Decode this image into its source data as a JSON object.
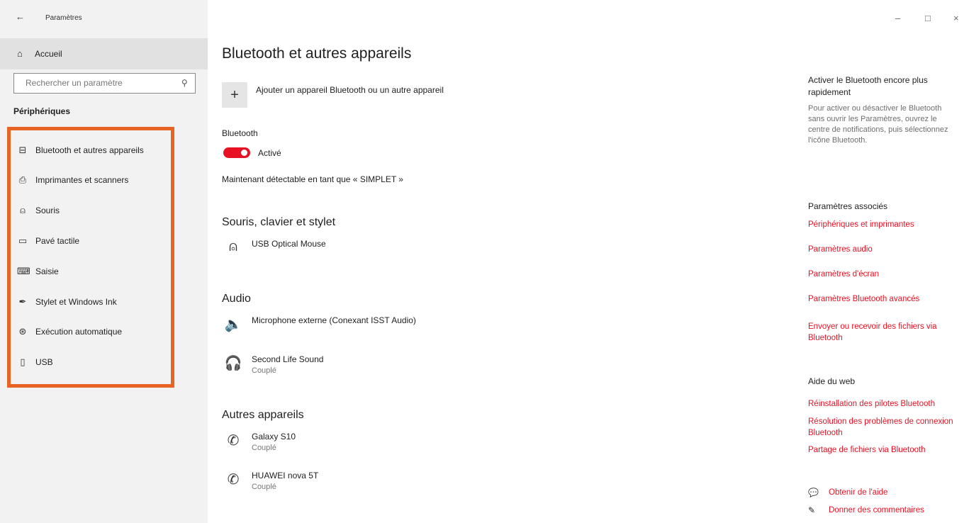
{
  "window": {
    "back_icon": "arrow-left-icon",
    "back_glyph": "←",
    "title": "Paramètres",
    "minimize": "–",
    "maximize": "□",
    "close": "×"
  },
  "sidebar": {
    "home": {
      "icon": "home-icon",
      "glyph": "⌂",
      "label": "Accueil"
    },
    "search": {
      "placeholder": "Rechercher un paramètre",
      "icon": "search-icon",
      "glyph": "⚲"
    },
    "section": "Périphériques",
    "items": [
      {
        "icon": "bluetooth-devices-icon",
        "glyph": "⊟",
        "label": "Bluetooth et autres appareils"
      },
      {
        "icon": "printer-icon",
        "glyph": "⎙",
        "label": "Imprimantes et scanners"
      },
      {
        "icon": "mouse-icon",
        "glyph": "⍝",
        "label": "Souris"
      },
      {
        "icon": "touchpad-icon",
        "glyph": "▭",
        "label": "Pavé tactile"
      },
      {
        "icon": "keyboard-icon",
        "glyph": "⌨",
        "label": "Saisie"
      },
      {
        "icon": "pen-icon",
        "glyph": "✒",
        "label": "Stylet et Windows Ink"
      },
      {
        "icon": "autoplay-icon",
        "glyph": "⊛",
        "label": "Exécution automatique"
      },
      {
        "icon": "usb-icon",
        "glyph": "▯",
        "label": "USB"
      }
    ],
    "highlight_color": "#e86424"
  },
  "main": {
    "title": "Bluetooth et autres appareils",
    "add_icon": "plus-icon",
    "add_glyph": "+",
    "add_label": "Ajouter un appareil Bluetooth ou un autre appareil",
    "bluetooth_label": "Bluetooth",
    "toggle_state": "Activé",
    "toggle_on": true,
    "toggle_color": "#e81123",
    "discoverable": "Maintenant détectable en tant que « SIMPLET »",
    "groups": [
      {
        "title": "Souris, clavier et stylet",
        "devices": [
          {
            "icon": "mouse-icon",
            "glyph": "⍝",
            "name": "USB Optical Mouse",
            "status": ""
          }
        ]
      },
      {
        "title": "Audio",
        "devices": [
          {
            "icon": "speaker-icon",
            "glyph": "🔈",
            "name": "Microphone externe (Conexant ISST Audio)",
            "status": ""
          },
          {
            "icon": "headset-icon",
            "glyph": "🎧",
            "name": "Second Life Sound",
            "status": "Couplé"
          }
        ]
      },
      {
        "title": "Autres appareils",
        "devices": [
          {
            "icon": "phone-icon",
            "glyph": "✆",
            "name": "Galaxy S10",
            "status": "Couplé"
          },
          {
            "icon": "phone-icon",
            "glyph": "✆",
            "name": "HUAWEI nova 5T",
            "status": "Couplé"
          }
        ]
      }
    ]
  },
  "right": {
    "tip_title": "Activer le Bluetooth encore plus rapidement",
    "tip_body": "Pour activer ou désactiver le Bluetooth sans ouvrir les Paramètres, ouvrez le centre de notifications, puis sélectionnez l'icône Bluetooth.",
    "related_head": "Paramètres associés",
    "related_links": [
      "Périphériques et imprimantes",
      "Paramètres audio",
      "Paramètres d'écran",
      "Paramètres Bluetooth avancés",
      "Envoyer ou recevoir des fichiers via Bluetooth"
    ],
    "web_head": "Aide du web",
    "web_links": [
      "Réinstallation des pilotes Bluetooth",
      "Résolution des problèmes de connexion Bluetooth",
      "Partage de fichiers via Bluetooth"
    ],
    "help": [
      {
        "icon": "get-help-icon",
        "glyph": "💬",
        "label": "Obtenir de l'aide"
      },
      {
        "icon": "feedback-icon",
        "glyph": "✎",
        "label": "Donner des commentaires"
      }
    ],
    "link_color": "#e81123"
  }
}
